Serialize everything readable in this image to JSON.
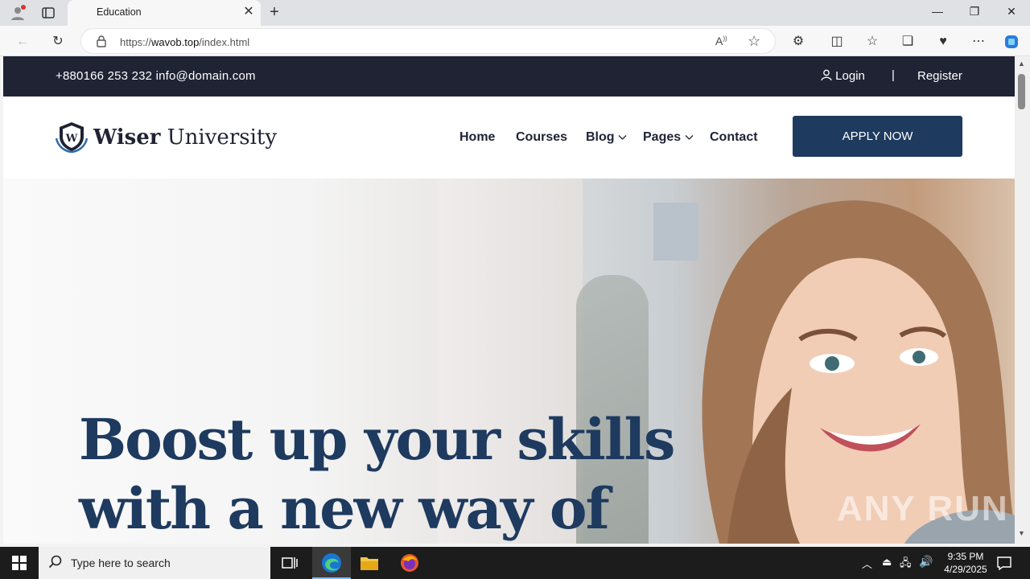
{
  "browser": {
    "tab_title": "Education",
    "url_prefix": "https://",
    "url_domain": "wavob.top",
    "url_path": "/index.html"
  },
  "topbar": {
    "contact": "+880166 253 232 info@domain.com",
    "login": "Login",
    "separator": "|",
    "register": "Register"
  },
  "navbar": {
    "brand_bold": "Wiser",
    "brand_rest": " University",
    "items": [
      {
        "label": "Home"
      },
      {
        "label": "Courses"
      },
      {
        "label": "Blog"
      },
      {
        "label": "Pages"
      },
      {
        "label": "Contact"
      }
    ],
    "apply": "APPLY NOW"
  },
  "hero": {
    "line1": "Boost up your skills",
    "line2": "with a new way of"
  },
  "taskbar": {
    "search_placeholder": "Type here to search",
    "time": "9:35 PM",
    "date": "4/29/2025"
  },
  "watermark": "ANY RUN",
  "colors": {
    "topbar_bg": "#1f2334",
    "accent_navy": "#1e3a5f",
    "text_dark": "#1f2334"
  }
}
